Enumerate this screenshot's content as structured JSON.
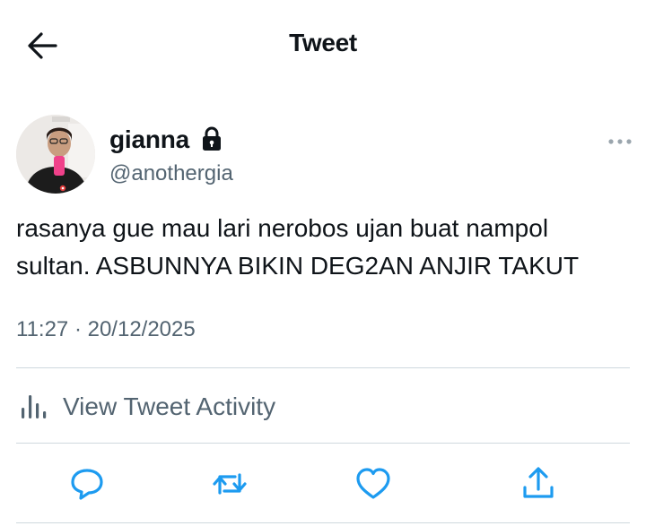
{
  "header": {
    "title": "Tweet"
  },
  "tweet": {
    "author": {
      "name": "gianna",
      "handle": "@anothergia",
      "protected": true
    },
    "text_lines": [
      "rasanya gue mau lari nerobos ujan buat nampol",
      "sultan. ASBUNNYA BIKIN DEG2AN ANJIR TAKUT"
    ],
    "timestamp": "11:27 · 20/12/2025"
  },
  "activity": {
    "label": "View Tweet Activity"
  },
  "actions": [
    "reply-icon",
    "retweet-icon",
    "like-icon",
    "share-icon"
  ],
  "colors": {
    "text": "#0f1419",
    "secondary": "#536471",
    "divider": "#cfd9de",
    "action_icon": "#1d9bf0"
  }
}
